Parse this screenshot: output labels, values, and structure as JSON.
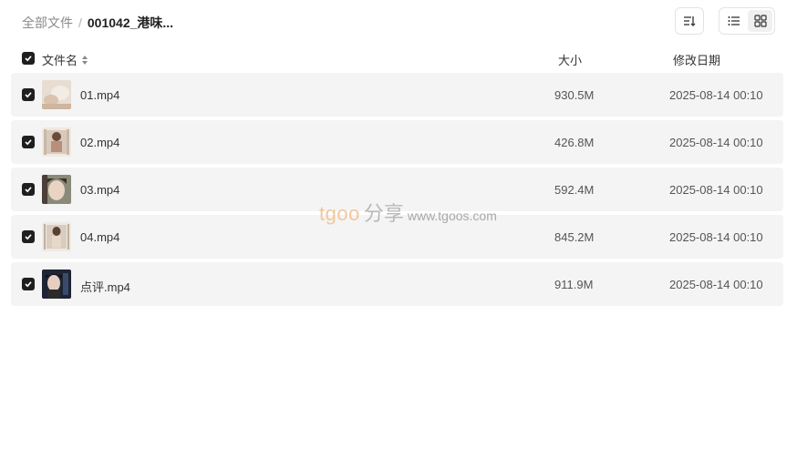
{
  "breadcrumb": {
    "root": "全部文件",
    "separator": "/",
    "current": "001042_港味..."
  },
  "toolbar": {
    "sort_icon": "sort-lines-icon",
    "list_view_icon": "list-view-icon",
    "grid_view_icon": "grid-view-icon",
    "active_view": "list"
  },
  "table": {
    "headers": {
      "name": "文件名",
      "size": "大小",
      "date": "修改日期"
    },
    "all_selected": true,
    "rows": [
      {
        "name": "01.mp4",
        "size": "930.5M",
        "date": "2025-08-14 00:10",
        "selected": true
      },
      {
        "name": "02.mp4",
        "size": "426.8M",
        "date": "2025-08-14 00:10",
        "selected": true
      },
      {
        "name": "03.mp4",
        "size": "592.4M",
        "date": "2025-08-14 00:10",
        "selected": true
      },
      {
        "name": "04.mp4",
        "size": "845.2M",
        "date": "2025-08-14 00:10",
        "selected": true
      },
      {
        "name": "点评.mp4",
        "size": "911.9M",
        "date": "2025-08-14 00:10",
        "selected": true
      }
    ]
  },
  "watermark": {
    "brand": "tgoo",
    "cn": "分享",
    "url": "www.tgoos.com"
  },
  "colors": {
    "row_bg": "#f4f4f4",
    "checkbox": "#1f1f1f",
    "watermark_brand": "#f3c79b"
  }
}
